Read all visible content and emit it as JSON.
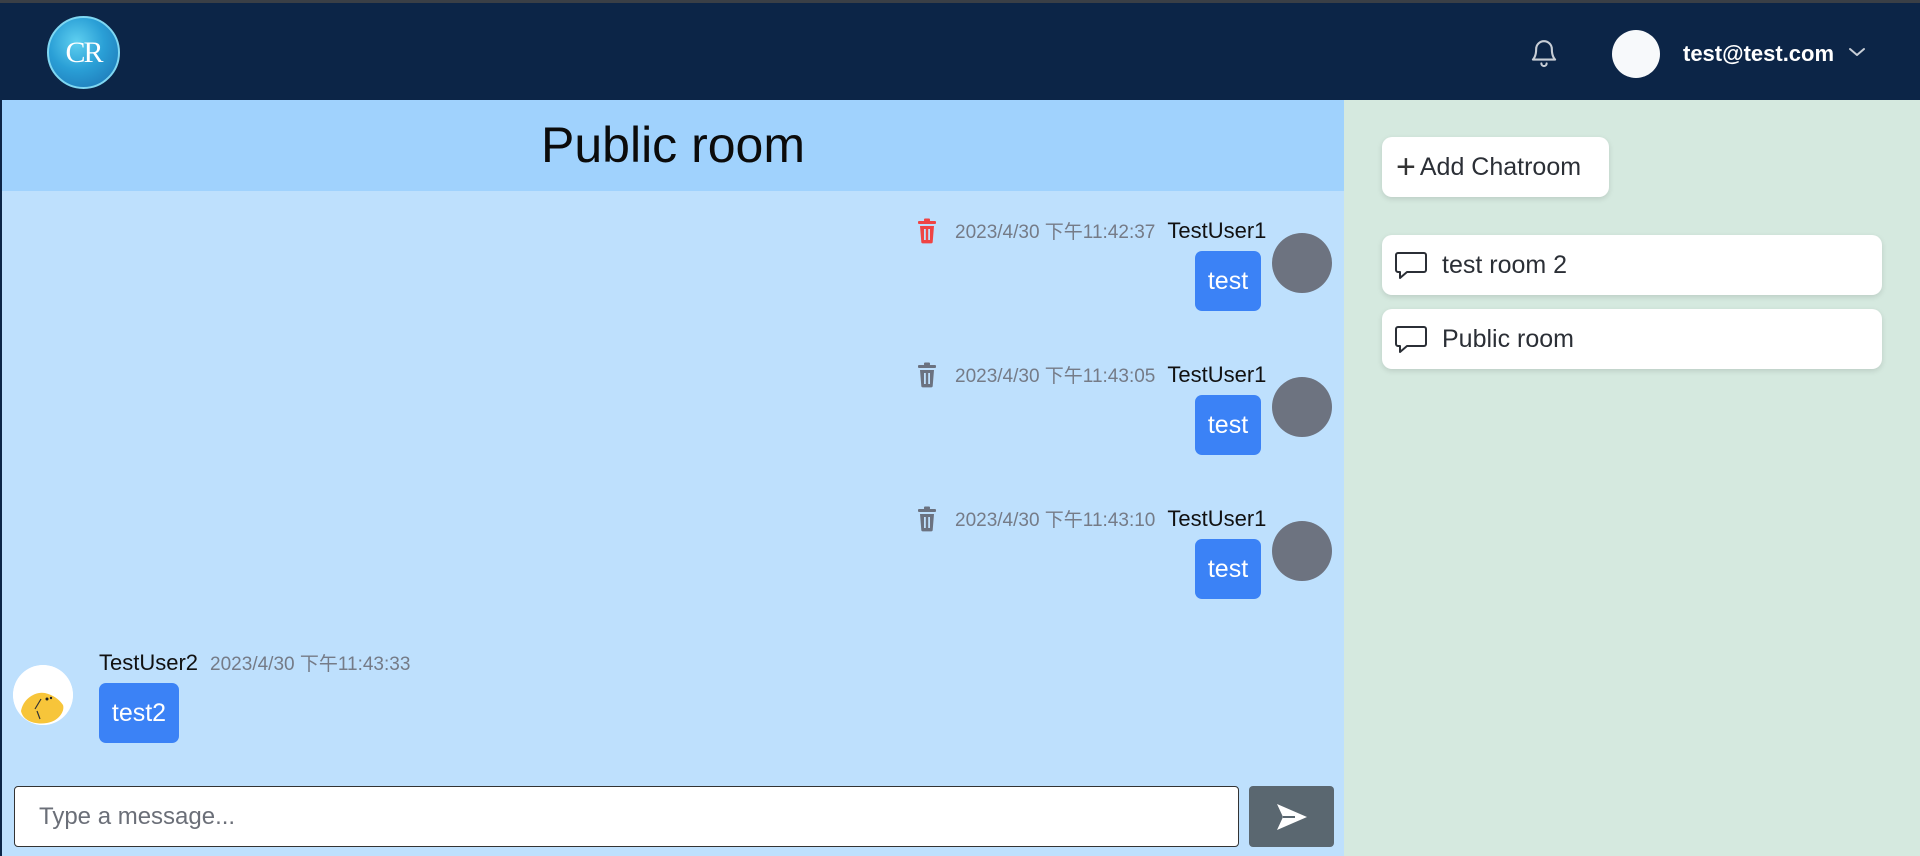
{
  "header": {
    "logo_text": "CR",
    "user_email": "test@test.com"
  },
  "chat": {
    "room_title": "Public room",
    "messages": [
      {
        "user": "TestUser1",
        "timestamp": "2023/4/30 下午11:42:37",
        "text": "test",
        "own": true
      },
      {
        "user": "TestUser1",
        "timestamp": "2023/4/30 下午11:43:05",
        "text": "test",
        "own": true
      },
      {
        "user": "TestUser1",
        "timestamp": "2023/4/30 下午11:43:10",
        "text": "test",
        "own": true
      },
      {
        "user": "TestUser2",
        "timestamp": "2023/4/30 下午11:43:33",
        "text": "test2",
        "own": false
      }
    ],
    "input": {
      "placeholder": "Type a message...",
      "value": ""
    }
  },
  "sidebar": {
    "add_label": "Add Chatroom",
    "rooms": [
      {
        "label": "test room 2"
      },
      {
        "label": "Public room"
      }
    ]
  },
  "colors": {
    "navbar": "#0c2547",
    "chat_bg": "#bee0fd",
    "room_header_bg": "#a0d2fd",
    "bubble": "#3b82f6",
    "sidebar_bg": "#d5e9df",
    "trash_active": "#ef4444",
    "trash_default": "#6b7280",
    "send_button": "#5a6770"
  },
  "icons": {
    "notification": "bell-icon",
    "menu": "chevron-down-icon",
    "delete": "trash-icon",
    "send": "send-icon",
    "add": "plus-icon",
    "room": "chat-bubble-icon"
  }
}
